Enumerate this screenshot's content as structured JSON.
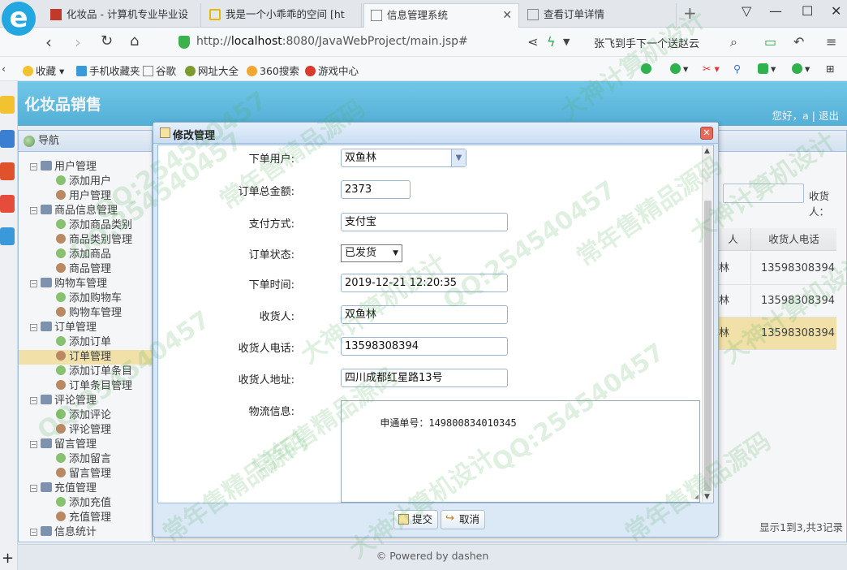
{
  "browser": {
    "tabs": [
      {
        "title": "化妆品 - 计算机专业毕业设"
      },
      {
        "title": "我是一个小乖乖的空间 [ht"
      },
      {
        "title": "信息管理系统",
        "active": true
      },
      {
        "title": "查看订单详情"
      }
    ],
    "url_prefix": "http://",
    "url_host": "localhost",
    "url_rest": ":8080/JavaWebProject/main.jsp#",
    "search_text": "张飞到手下一个送赵云",
    "bookmarks": [
      "收藏",
      "手机收藏夹",
      "谷歌",
      "网址大全",
      "360搜索",
      "游戏中心"
    ]
  },
  "app": {
    "title": "化妆品销售",
    "greeting": "您好，a |",
    "logout": "退出",
    "footer": "© Powered by dashen"
  },
  "nav": {
    "title": "导航",
    "groups": [
      {
        "label": "用户管理",
        "children": [
          "添加用户",
          "用户管理"
        ]
      },
      {
        "label": "商品信息管理",
        "children": [
          "添加商品类别",
          "商品类别管理",
          "添加商品",
          "商品管理"
        ]
      },
      {
        "label": "购物车管理",
        "children": [
          "添加购物车",
          "购物车管理"
        ]
      },
      {
        "label": "订单管理",
        "children": [
          "添加订单",
          "订单管理",
          "添加订单条目",
          "订单条目管理"
        ],
        "selected_child": 1
      },
      {
        "label": "评论管理",
        "children": [
          "添加评论",
          "评论管理"
        ]
      },
      {
        "label": "留言管理",
        "children": [
          "添加留言",
          "留言管理"
        ]
      },
      {
        "label": "充值管理",
        "children": [
          "添加充值",
          "充值管理"
        ]
      },
      {
        "label": "信息统计",
        "children": []
      }
    ]
  },
  "grid": {
    "search_label": "收货人：",
    "columns": [
      "人",
      "收货人电话"
    ],
    "rows": [
      {
        "name": "林",
        "phone": "13598308394"
      },
      {
        "name": "林",
        "phone": "13598308394"
      },
      {
        "name": "林",
        "phone": "13598308394",
        "selected": true
      }
    ],
    "pager": "显示1到3,共3记录"
  },
  "dialog": {
    "title": "修改管理",
    "fields": {
      "user": {
        "label": "下单用户:",
        "value": "双鱼林"
      },
      "total": {
        "label": "订单总金额:",
        "value": "2373"
      },
      "payment": {
        "label": "支付方式:",
        "value": "支付宝"
      },
      "status": {
        "label": "订单状态:",
        "value": "已发货"
      },
      "order_time": {
        "label": "下单时间:",
        "value": "2019-12-21 12:20:35"
      },
      "receiver": {
        "label": "收货人:",
        "value": "双鱼林"
      },
      "receiver_phone": {
        "label": "收货人电话:",
        "value": "13598308394"
      },
      "address": {
        "label": "收货人地址:",
        "value": "四川成都红星路13号"
      },
      "logistics": {
        "label": "物流信息:",
        "value": "申通单号：149800834010345"
      }
    },
    "submit": "提交",
    "cancel": "取消"
  },
  "watermarks": [
    "QQ:254540457",
    "常年售精品源码",
    "大神计算机设计"
  ]
}
